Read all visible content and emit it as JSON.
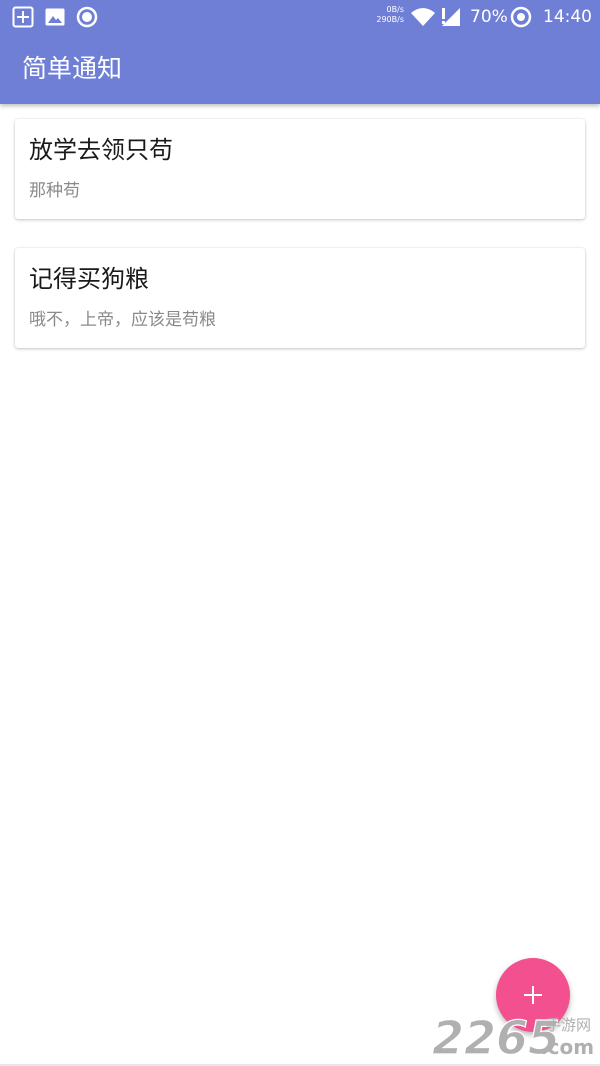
{
  "status_bar": {
    "net_speed_up": "0B/s",
    "net_speed_down": "290B/s",
    "battery_percent": "70%",
    "time": "14:40",
    "icons": [
      "add-box-icon",
      "image-icon",
      "circle-notification-icon",
      "wifi-icon",
      "signal-icon",
      "battery-saver-icon"
    ]
  },
  "app_bar": {
    "title": "简单通知"
  },
  "notes": [
    {
      "title": "放学去领只苟",
      "description": "那种苟"
    },
    {
      "title": "记得买狗粮",
      "description": "哦不，上帝，应该是苟粮"
    }
  ],
  "fab": {
    "icon": "plus-icon"
  },
  "watermark": {
    "number": "2265",
    "cn_text": "手游网",
    "domain": ".com"
  },
  "colors": {
    "primary": "#6f7fd6",
    "accent": "#f2508f",
    "title_text": "#1a1a1a",
    "secondary_text": "#8a8a8a",
    "watermark": "#b0b0b0"
  }
}
